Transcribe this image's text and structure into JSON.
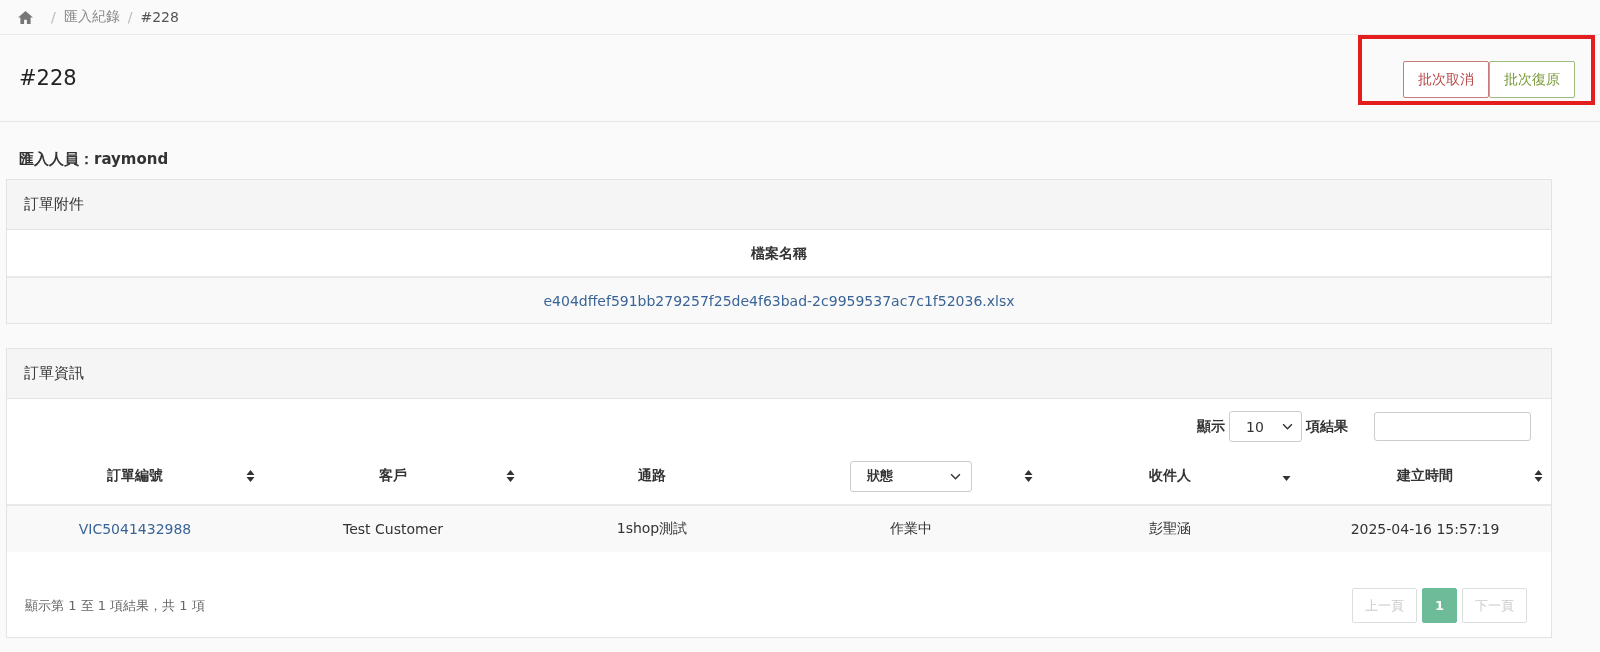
{
  "breadcrumb": [
    {
      "separator": "/",
      "label": "匯入紀錄",
      "current": false
    },
    {
      "separator": "/",
      "label": "#228",
      "current": true
    }
  ],
  "page_title": "#228",
  "actions": [
    {
      "label": "批次取消",
      "kind": "danger"
    },
    {
      "label": "批次復原",
      "kind": "success"
    }
  ],
  "importer": {
    "label": "匯入人員：",
    "value": "raymond"
  },
  "attachments": {
    "title": "訂單附件",
    "column": "檔案名稱",
    "files": [
      "e404dffef591bb279257f25de4f63bad-2c9959537ac7c1f52036.xlsx"
    ]
  },
  "orders": {
    "title": "訂單資訊",
    "length": {
      "label_before": "顯示",
      "value": "10",
      "label_after": "項結果"
    },
    "columns": [
      {
        "label": "訂單編號",
        "kind": "text",
        "sortable": true
      },
      {
        "label": "客戶",
        "kind": "text",
        "sortable": true
      },
      {
        "label": "通路",
        "kind": "text",
        "sortable": false
      },
      {
        "label": "狀態",
        "kind": "select",
        "sortable": true
      },
      {
        "label": "收件人",
        "kind": "text",
        "sortable": true,
        "sorted_descending": true
      },
      {
        "label": "建立時間",
        "kind": "text",
        "sortable": true
      }
    ],
    "rows": [
      {
        "cells": [
          {
            "text": "VIC5041432988",
            "link": true
          },
          {
            "text": "Test Customer",
            "link": false
          },
          {
            "text": "1shop測試",
            "link": false
          },
          {
            "text": "作業中",
            "link": false
          },
          {
            "text": "彭聖涵",
            "link": false
          },
          {
            "text": "2025-04-16 15:57:19",
            "link": false
          }
        ]
      }
    ],
    "info": "顯示第 1 至 1 項結果，共 1 項",
    "pagination": [
      {
        "label": "上一頁",
        "disabled": true,
        "selected": false
      },
      {
        "label": "1",
        "disabled": false,
        "selected": true
      },
      {
        "label": "下一頁",
        "disabled": true,
        "selected": false
      }
    ]
  }
}
